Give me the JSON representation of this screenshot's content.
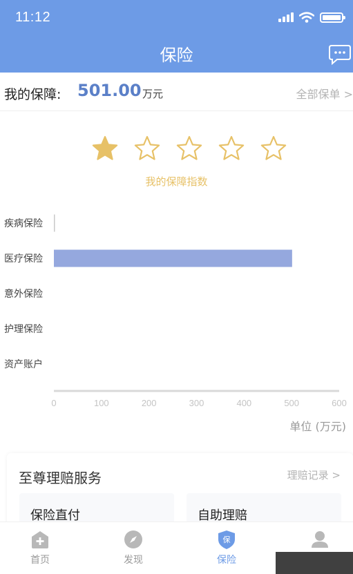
{
  "status_bar": {
    "time": "11:12"
  },
  "header": {
    "title": "保险",
    "message_icon": "chat-bubble-icon"
  },
  "summary": {
    "label": "我的保障:",
    "amount": "501.00",
    "unit": "万元",
    "all_policies": "全部保单 >"
  },
  "rating": {
    "stars_filled": 1,
    "stars_total": 5,
    "caption": "我的保障指数",
    "color": "#e7c167"
  },
  "chart_data": {
    "type": "bar",
    "orientation": "horizontal",
    "categories": [
      "疾病保险",
      "医疗保险",
      "意外保险",
      "护理保险",
      "资产账户"
    ],
    "values": [
      1,
      501,
      0,
      0,
      0
    ],
    "xlim": [
      0,
      600
    ],
    "ticks": [
      "0",
      "100",
      "200",
      "300",
      "400",
      "500",
      "600"
    ],
    "unit_label": "单位 (万元)",
    "bar_color": "#95a8de",
    "grid": false
  },
  "services": {
    "title": "至尊理赔服务",
    "record_link": "理赔记录 >",
    "tiles": [
      "保险直付",
      "自助理赔"
    ]
  },
  "tabbar": {
    "items": [
      {
        "label": "首页",
        "icon": "home-plus-icon"
      },
      {
        "label": "发现",
        "icon": "compass-icon"
      },
      {
        "label": "保险",
        "icon": "shield-icon",
        "active": true
      },
      {
        "label": "",
        "icon": "profile-icon"
      }
    ],
    "accent": "#6d9be6"
  }
}
